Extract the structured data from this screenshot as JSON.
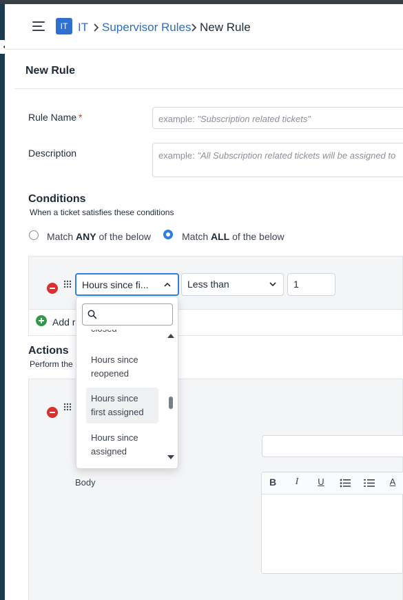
{
  "breadcrumb": {
    "badge": "IT",
    "items": [
      {
        "label": "IT"
      },
      {
        "label": "Supervisor Rules"
      },
      {
        "label": "New Rule"
      }
    ]
  },
  "page": {
    "title": "New Rule"
  },
  "form": {
    "rule_name": {
      "label": "Rule Name",
      "required_mark": "*",
      "placeholder_prefix": "example: ",
      "placeholder_example": "\"Subscription related tickets\""
    },
    "description": {
      "label": "Description",
      "placeholder_prefix": "example: ",
      "placeholder_example": "\"All Subscription related tickets will be assigned to"
    }
  },
  "conditions": {
    "title": "Conditions",
    "subtitle": "When a ticket satisfies these conditions",
    "match_options": [
      {
        "pre": "Match ",
        "bold": "ANY",
        "post": " of the below",
        "selected": false
      },
      {
        "pre": "Match ",
        "bold": "ALL",
        "post": " of the below",
        "selected": true
      }
    ],
    "row": {
      "field": "Hours since fi...",
      "operator": "Less than",
      "value": "1"
    },
    "add_label": "Add r"
  },
  "field_dropdown": {
    "search_placeholder": "",
    "options": [
      {
        "label": "closed",
        "highlighted": false
      },
      {
        "label": "Hours since reopened",
        "highlighted": false
      },
      {
        "label": "Hours since first assigned",
        "highlighted": true
      },
      {
        "label": "Hours since assigned",
        "highlighted": false
      }
    ]
  },
  "actions": {
    "title": "Actions",
    "subtitle": "Perform the",
    "body_label": "Body",
    "subject_value": ""
  },
  "editor_toolbar": {
    "bold": "B",
    "italic": "I",
    "underline": "U",
    "font_color": "A"
  },
  "colors": {
    "accent": "#2f7fe0",
    "link": "#2f6fbf",
    "danger": "#d93030",
    "success": "#2c9a4a",
    "sidebar": "#1b3a4e"
  }
}
